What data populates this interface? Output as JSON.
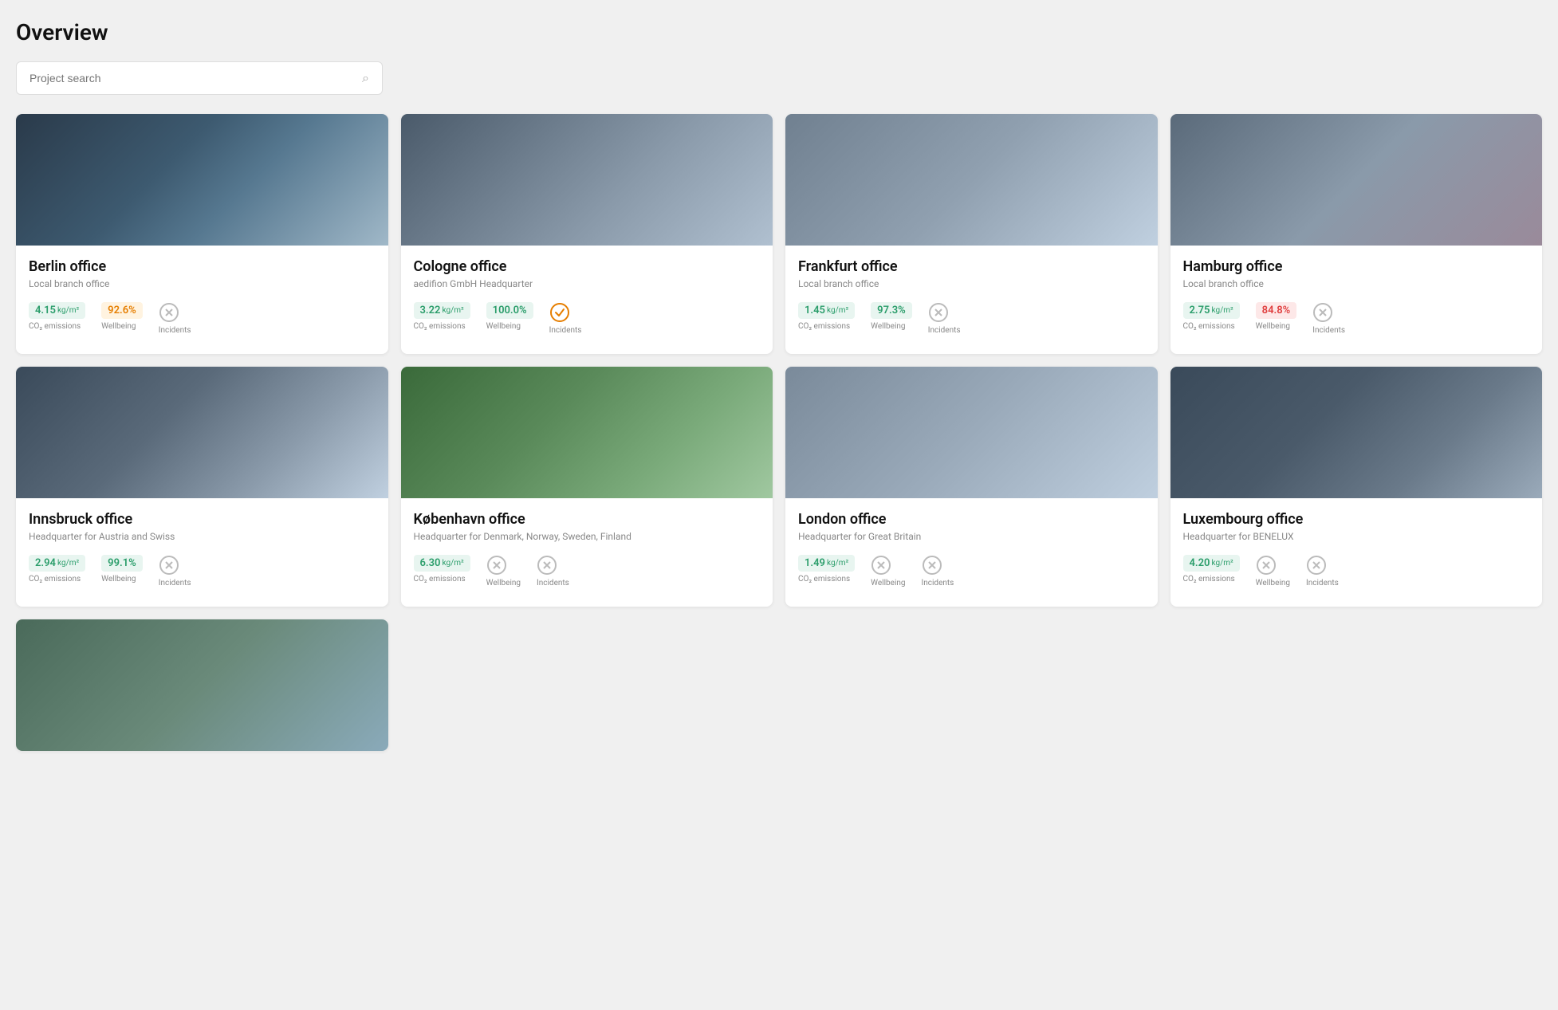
{
  "page": {
    "title": "Overview",
    "search_placeholder": "Project search"
  },
  "offices": [
    {
      "id": "berlin",
      "name": "Berlin office",
      "subtitle": "Local branch office",
      "img_class": "img-berlin",
      "co2": "4.15",
      "co2_unit": "kg/m²",
      "wellbeing": "92.6",
      "wellbeing_pct": "%",
      "wellbeing_class": "badge-wellbeing-orange",
      "incidents_icon": "circle-x",
      "incidents_label": "Incidents",
      "co2_label": "CO₂ emissions",
      "wellbeing_label": "Wellbeing"
    },
    {
      "id": "cologne",
      "name": "Cologne office",
      "subtitle": "aedifion GmbH Headquarter",
      "img_class": "img-cologne",
      "co2": "3.22",
      "co2_unit": "kg/m²",
      "wellbeing": "100.0",
      "wellbeing_pct": "%",
      "wellbeing_class": "badge-wellbeing-green",
      "incidents_icon": "circle-check",
      "incidents_label": "Incidents",
      "co2_label": "CO₂ emissions",
      "wellbeing_label": "Wellbeing"
    },
    {
      "id": "frankfurt",
      "name": "Frankfurt office",
      "subtitle": "Local branch office",
      "img_class": "img-frankfurt",
      "co2": "1.45",
      "co2_unit": "kg/m²",
      "wellbeing": "97.3",
      "wellbeing_pct": "%",
      "wellbeing_class": "badge-wellbeing-green",
      "incidents_icon": "circle-x",
      "incidents_label": "Incidents",
      "co2_label": "CO₂ emissions",
      "wellbeing_label": "Wellbeing"
    },
    {
      "id": "hamburg",
      "name": "Hamburg office",
      "subtitle": "Local branch office",
      "img_class": "img-hamburg",
      "co2": "2.75",
      "co2_unit": "kg/m²",
      "wellbeing": "84.8",
      "wellbeing_pct": "%",
      "wellbeing_class": "badge-wellbeing-red",
      "incidents_icon": "circle-x",
      "incidents_label": "Incidents",
      "co2_label": "CO₂ emissions",
      "wellbeing_label": "Wellbeing"
    },
    {
      "id": "innsbruck",
      "name": "Innsbruck office",
      "subtitle": "Headquarter for Austria and Swiss",
      "img_class": "img-innsbruck",
      "co2": "2.94",
      "co2_unit": "kg/m²",
      "wellbeing": "99.1",
      "wellbeing_pct": "%",
      "wellbeing_class": "badge-wellbeing-green",
      "incidents_icon": "circle-x",
      "incidents_label": "Incidents",
      "co2_label": "CO₂ emissions",
      "wellbeing_label": "Wellbeing"
    },
    {
      "id": "kobenhavn",
      "name": "København office",
      "subtitle": "Headquarter for Denmark, Norway, Sweden, Finland",
      "img_class": "img-kobenhavn",
      "co2": "6.30",
      "co2_unit": "kg/m²",
      "wellbeing": "",
      "wellbeing_pct": "",
      "wellbeing_class": "",
      "incidents_icon": "circle-x",
      "incidents_label": "Incidents",
      "co2_label": "CO₂ emissions",
      "wellbeing_label": "Wellbeing",
      "no_wellbeing": true
    },
    {
      "id": "london",
      "name": "London office",
      "subtitle": "Headquarter for Great Britain",
      "img_class": "img-london",
      "co2": "1.49",
      "co2_unit": "kg/m²",
      "wellbeing": "",
      "wellbeing_pct": "",
      "wellbeing_class": "",
      "incidents_icon": "circle-x",
      "incidents_label": "Incidents",
      "co2_label": "CO₂ emissions",
      "wellbeing_label": "Wellbeing",
      "no_wellbeing": true
    },
    {
      "id": "luxembourg",
      "name": "Luxembourg office",
      "subtitle": "Headquarter for BENELUX",
      "img_class": "img-luxembourg",
      "co2": "4.20",
      "co2_unit": "kg/m²",
      "wellbeing": "",
      "wellbeing_pct": "",
      "wellbeing_class": "",
      "incidents_icon": "circle-x",
      "incidents_label": "Incidents",
      "co2_label": "CO₂ emissions",
      "wellbeing_label": "Wellbeing",
      "no_wellbeing": true
    }
  ],
  "last_card": {
    "img_class": "img-last"
  }
}
